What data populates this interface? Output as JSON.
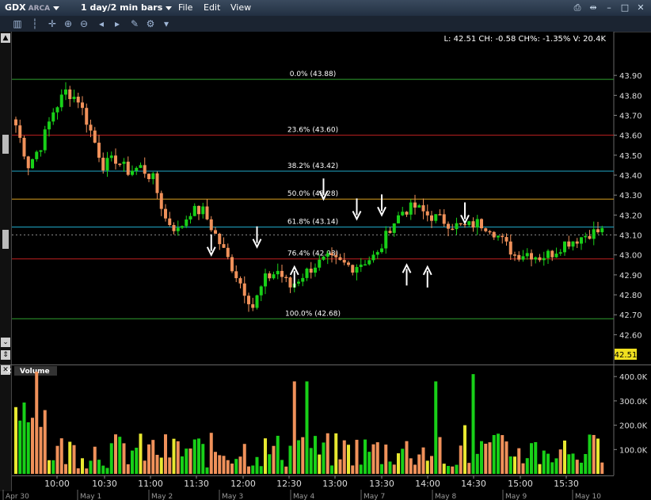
{
  "titlebar": {
    "symbol": "GDX",
    "exchange": "ARCA",
    "period": "1 day/2 min bars",
    "menu": [
      "File",
      "Edit",
      "View"
    ]
  },
  "toolbar": {
    "icons": [
      "bar-chart-icon",
      "candlestick-icon",
      "crosshair-icon",
      "zoom-in-icon",
      "zoom-out-icon",
      "scroll-left-icon",
      "scroll-right-icon",
      "draw-tool-icon",
      "settings-icon",
      "dropdown-icon"
    ]
  },
  "quote_line": "L: 42.51  CH: -0.58  CH%: -1.35%  V: 20.4K",
  "last_price_tag": "42.51",
  "volume_panel": {
    "title": "Volume",
    "close": "×"
  },
  "colors": {
    "up": "#18d018",
    "down": "#f0915a",
    "neutral": "#e8e830",
    "fib_green": "#2fa02f",
    "fib_red": "#c02020",
    "fib_cyan": "#20a8c8",
    "fib_orange": "#d8a020",
    "arrow": "#ffffff"
  },
  "chart_data": [
    {
      "type": "candlestick",
      "ylim": [
        42.55,
        43.98
      ],
      "y_ticks": [
        "43.90",
        "43.80",
        "43.70",
        "43.60",
        "43.50",
        "43.40",
        "43.30",
        "43.20",
        "43.10",
        "43.00",
        "42.90",
        "42.80",
        "42.70",
        "42.60"
      ],
      "x_time_labels": [
        "10:00",
        "10:30",
        "11:00",
        "11:30",
        "12:00",
        "12:30",
        "13:00",
        "13:30",
        "14:00",
        "14:30",
        "15:00",
        "15:30"
      ],
      "x_date_labels": [
        "Apr 30",
        "May 1",
        "May 2",
        "May 3",
        "May 4",
        "May 7",
        "May 8",
        "May 9",
        "May 10"
      ],
      "fib_levels": [
        {
          "label": "0.0% (43.88)",
          "value": 43.88,
          "color": "fib_green"
        },
        {
          "label": "23.6% (43.60)",
          "value": 43.6,
          "color": "fib_red"
        },
        {
          "label": "38.2% (43.42)",
          "value": 43.42,
          "color": "fib_cyan"
        },
        {
          "label": "50.0% (43.28)",
          "value": 43.28,
          "color": "fib_orange"
        },
        {
          "label": "61.8% (43.14)",
          "value": 43.14,
          "color": "fib_cyan"
        },
        {
          "label": "76.4% (42.98)",
          "value": 42.98,
          "color": "fib_red"
        },
        {
          "label": "100.0% (42.68)",
          "value": 42.68,
          "color": "fib_green"
        }
      ],
      "dotted_last": 43.1,
      "path": [
        [
          0,
          43.65
        ],
        [
          3,
          43.45
        ],
        [
          6,
          43.55
        ],
        [
          9,
          43.72
        ],
        [
          12,
          43.82
        ],
        [
          15,
          43.78
        ],
        [
          18,
          43.62
        ],
        [
          21,
          43.45
        ],
        [
          24,
          43.48
        ],
        [
          27,
          43.42
        ],
        [
          30,
          43.44
        ],
        [
          33,
          43.38
        ],
        [
          36,
          43.18
        ],
        [
          39,
          43.12
        ],
        [
          42,
          43.22
        ],
        [
          45,
          43.22
        ],
        [
          48,
          43.1
        ],
        [
          51,
          42.98
        ],
        [
          54,
          42.86
        ],
        [
          57,
          42.74
        ],
        [
          60,
          42.88
        ],
        [
          63,
          42.92
        ],
        [
          66,
          42.84
        ],
        [
          69,
          42.9
        ],
        [
          72,
          42.95
        ],
        [
          75,
          42.98
        ],
        [
          78,
          42.96
        ],
        [
          81,
          42.94
        ],
        [
          84,
          42.97
        ],
        [
          87,
          43.0
        ],
        [
          90,
          43.14
        ],
        [
          93,
          43.22
        ],
        [
          96,
          43.24
        ],
        [
          99,
          43.2
        ],
        [
          102,
          43.18
        ],
        [
          105,
          43.15
        ],
        [
          108,
          43.14
        ],
        [
          111,
          43.16
        ],
        [
          114,
          43.14
        ],
        [
          117,
          43.07
        ],
        [
          120,
          43.0
        ],
        [
          123,
          43.01
        ],
        [
          126,
          42.99
        ],
        [
          129,
          43.01
        ],
        [
          132,
          43.06
        ],
        [
          135,
          43.08
        ],
        [
          138,
          43.11
        ],
        [
          141,
          43.12
        ]
      ],
      "arrows": [
        {
          "n": 47,
          "value": 43.0,
          "dir": "down"
        },
        {
          "n": 58,
          "value": 43.04,
          "dir": "down"
        },
        {
          "n": 67,
          "value": 42.94,
          "dir": "up"
        },
        {
          "n": 74,
          "value": 43.28,
          "dir": "down"
        },
        {
          "n": 82,
          "value": 43.18,
          "dir": "down"
        },
        {
          "n": 88,
          "value": 43.2,
          "dir": "down"
        },
        {
          "n": 94,
          "value": 42.95,
          "dir": "up"
        },
        {
          "n": 99,
          "value": 42.94,
          "dir": "up"
        },
        {
          "n": 108,
          "value": 43.16,
          "dir": "down"
        }
      ]
    },
    {
      "type": "bar",
      "title": "Volume",
      "y_ticks": [
        "400.0K",
        "300.0K",
        "200.0K",
        "100.0K"
      ],
      "ylim": [
        0,
        430000
      ],
      "spikes": [
        {
          "n": 5,
          "value": 420000
        },
        {
          "n": 67,
          "value": 380000
        },
        {
          "n": 70,
          "value": 380000
        },
        {
          "n": 101,
          "value": 380000
        },
        {
          "n": 108,
          "value": 200000
        },
        {
          "n": 110,
          "value": 410000
        }
      ]
    }
  ]
}
